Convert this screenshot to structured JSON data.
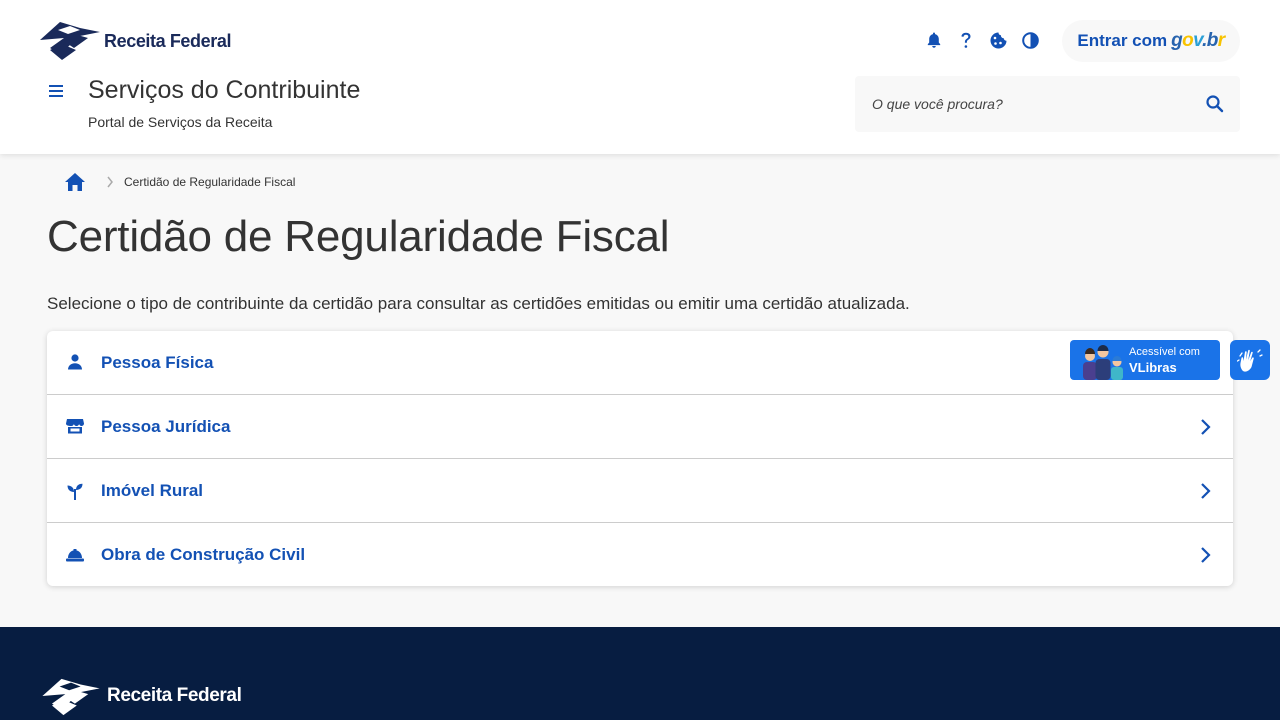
{
  "header": {
    "logo_text": "Receita Federal",
    "icons": [
      "bell-icon",
      "help-icon",
      "cookie-icon",
      "contrast-icon"
    ],
    "login": {
      "prefix": "Entrar com",
      "brand": "gov.br"
    },
    "site_title": "Serviços do Contribuinte",
    "site_subtitle": "Portal de Serviços da Receita",
    "search_placeholder": "O que você procura?"
  },
  "breadcrumb": {
    "home_icon": "home-icon",
    "current": "Certidão de Regularidade Fiscal"
  },
  "main": {
    "title": "Certidão de Regularidade Fiscal",
    "intro": "Selecione o tipo de contribuinte da certidão para consultar as certidões emitidas ou emitir uma certidão atualizada.",
    "items": [
      {
        "label": "Pessoa Física",
        "icon": "person-icon"
      },
      {
        "label": "Pessoa Jurídica",
        "icon": "store-icon"
      },
      {
        "label": "Imóvel Rural",
        "icon": "sprout-icon"
      },
      {
        "label": "Obra de Construção Civil",
        "icon": "hard-hat-icon"
      }
    ]
  },
  "vlibras": {
    "small_text": "Acessível com",
    "big_text": "VLibras"
  },
  "footer": {
    "logo_text": "Receita Federal"
  },
  "colors": {
    "primary": "#1351b4",
    "footer_bg": "#071d41",
    "page_bg": "#f8f8f8",
    "vlibras_blue": "#1a73e8"
  }
}
